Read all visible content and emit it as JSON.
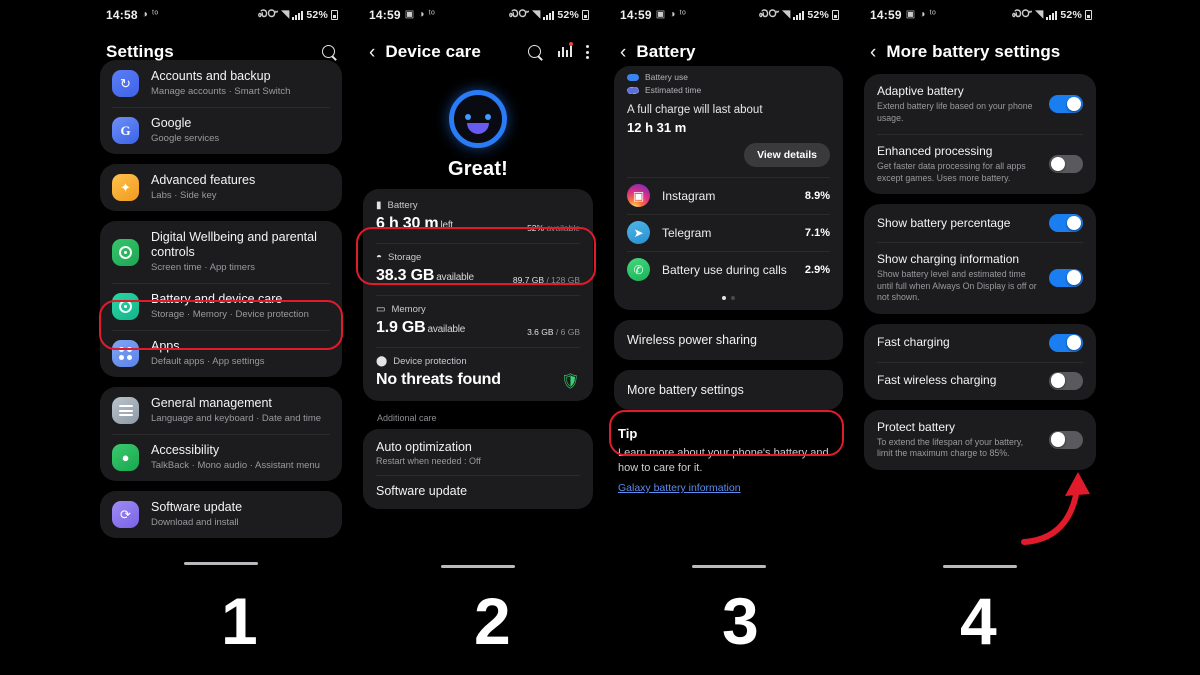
{
  "panels": [
    {
      "step": "1",
      "statusbar": {
        "time": "14:58",
        "battery": "52%"
      },
      "appbar": {
        "title": "Settings",
        "search_icon": "search-icon"
      },
      "items": [
        {
          "title": "Accounts and backup",
          "subtitle": "Manage accounts  ·  Smart Switch",
          "icon": "accounts-icon"
        },
        {
          "title": "Google",
          "subtitle": "Google services",
          "icon": "google-icon"
        },
        {
          "title": "Advanced features",
          "subtitle": "Labs  ·  Side key",
          "icon": "advanced-features-icon"
        },
        {
          "title": "Digital Wellbeing and parental controls",
          "subtitle": "Screen time  ·  App timers",
          "icon": "digital-wellbeing-icon"
        },
        {
          "title": "Battery and device care",
          "subtitle": "Storage  ·  Memory  ·  Device protection",
          "icon": "battery-device-care-icon"
        },
        {
          "title": "Apps",
          "subtitle": "Default apps  ·  App settings",
          "icon": "apps-icon"
        },
        {
          "title": "General management",
          "subtitle": "Language and keyboard  ·  Date and time",
          "icon": "general-management-icon"
        },
        {
          "title": "Accessibility",
          "subtitle": "TalkBack  ·  Mono audio  ·  Assistant menu",
          "icon": "accessibility-icon"
        },
        {
          "title": "Software update",
          "subtitle": "Download and install",
          "icon": "software-update-icon"
        }
      ]
    },
    {
      "step": "2",
      "statusbar": {
        "time": "14:59",
        "battery": "52%"
      },
      "appbar": {
        "title": "Device care",
        "back": "‹"
      },
      "status_text": "Great!",
      "cards": [
        {
          "label": "Battery",
          "value": "6 h 30 m",
          "unit": "left",
          "meta_bold": "52%",
          "meta_rest": " available",
          "fill": 62,
          "color": "#3ddc84",
          "icon": "battery-icon"
        },
        {
          "label": "Storage",
          "value": "38.3 GB",
          "unit": "available",
          "meta_bold": "89.7 GB",
          "meta_rest": " / 128 GB",
          "fill": 70,
          "color": "#2fd9c5",
          "icon": "storage-icon"
        },
        {
          "label": "Memory",
          "value": "1.9 GB",
          "unit": "available",
          "meta_bold": "3.6 GB",
          "meta_rest": " / 6 GB",
          "fill": 60,
          "color": "#3a8ef0",
          "icon": "memory-icon"
        },
        {
          "label": "Device protection",
          "value": "No threats found",
          "unit": "",
          "meta_bold": "",
          "meta_rest": "",
          "fill": 0,
          "color": "",
          "icon": "shield-icon"
        }
      ],
      "additional_label": "Additional care",
      "additional": [
        {
          "title": "Auto optimization",
          "subtitle": "Restart when needed : Off"
        },
        {
          "title": "Software update",
          "subtitle": ""
        }
      ]
    },
    {
      "step": "3",
      "statusbar": {
        "time": "14:59",
        "battery": "52%"
      },
      "appbar": {
        "title": "Battery",
        "back": "‹"
      },
      "legend": [
        "Battery use",
        "Estimated time"
      ],
      "full_charge_line": "A full charge will last about",
      "full_charge_value": "12 h 31 m",
      "view_details": "View details",
      "apps": [
        {
          "name": "Instagram",
          "pct": "8.9%",
          "icon": "instagram-icon"
        },
        {
          "name": "Telegram",
          "pct": "7.1%",
          "icon": "telegram-icon"
        },
        {
          "name": "Battery use during calls",
          "pct": "2.9%",
          "icon": "phone-icon"
        }
      ],
      "wireless_power_sharing": "Wireless power sharing",
      "more_battery_settings": "More battery settings",
      "tip_title": "Tip",
      "tip_text": "Learn more about your phone's battery and how to care for it.",
      "tip_link": "Galaxy battery information"
    },
    {
      "step": "4",
      "statusbar": {
        "time": "14:59",
        "battery": "52%"
      },
      "appbar": {
        "title": "More battery settings",
        "back": "‹"
      },
      "groups": [
        {
          "rows": [
            {
              "title": "Adaptive battery",
              "subtitle": "Extend battery life based on your phone usage.",
              "state": "on"
            },
            {
              "title": "Enhanced processing",
              "subtitle": "Get faster data processing for all apps except games. Uses more battery.",
              "state": "off"
            }
          ]
        },
        {
          "rows": [
            {
              "title": "Show battery percentage",
              "subtitle": "",
              "state": "on"
            },
            {
              "title": "Show charging information",
              "subtitle": "Show battery level and estimated time until full when Always On Display is off or not shown.",
              "state": "on"
            }
          ]
        },
        {
          "rows": [
            {
              "title": "Fast charging",
              "subtitle": "",
              "state": "on"
            },
            {
              "title": "Fast wireless charging",
              "subtitle": "",
              "state": "off"
            }
          ]
        },
        {
          "rows": [
            {
              "title": "Protect battery",
              "subtitle": "To extend the lifespan of your battery, limit the maximum charge to 85%.",
              "state": "off"
            }
          ]
        }
      ]
    }
  ],
  "accent": {
    "highlight": "#e01b2c",
    "toggle_on": "#1a7ef0",
    "link": "#5b8cf0"
  }
}
